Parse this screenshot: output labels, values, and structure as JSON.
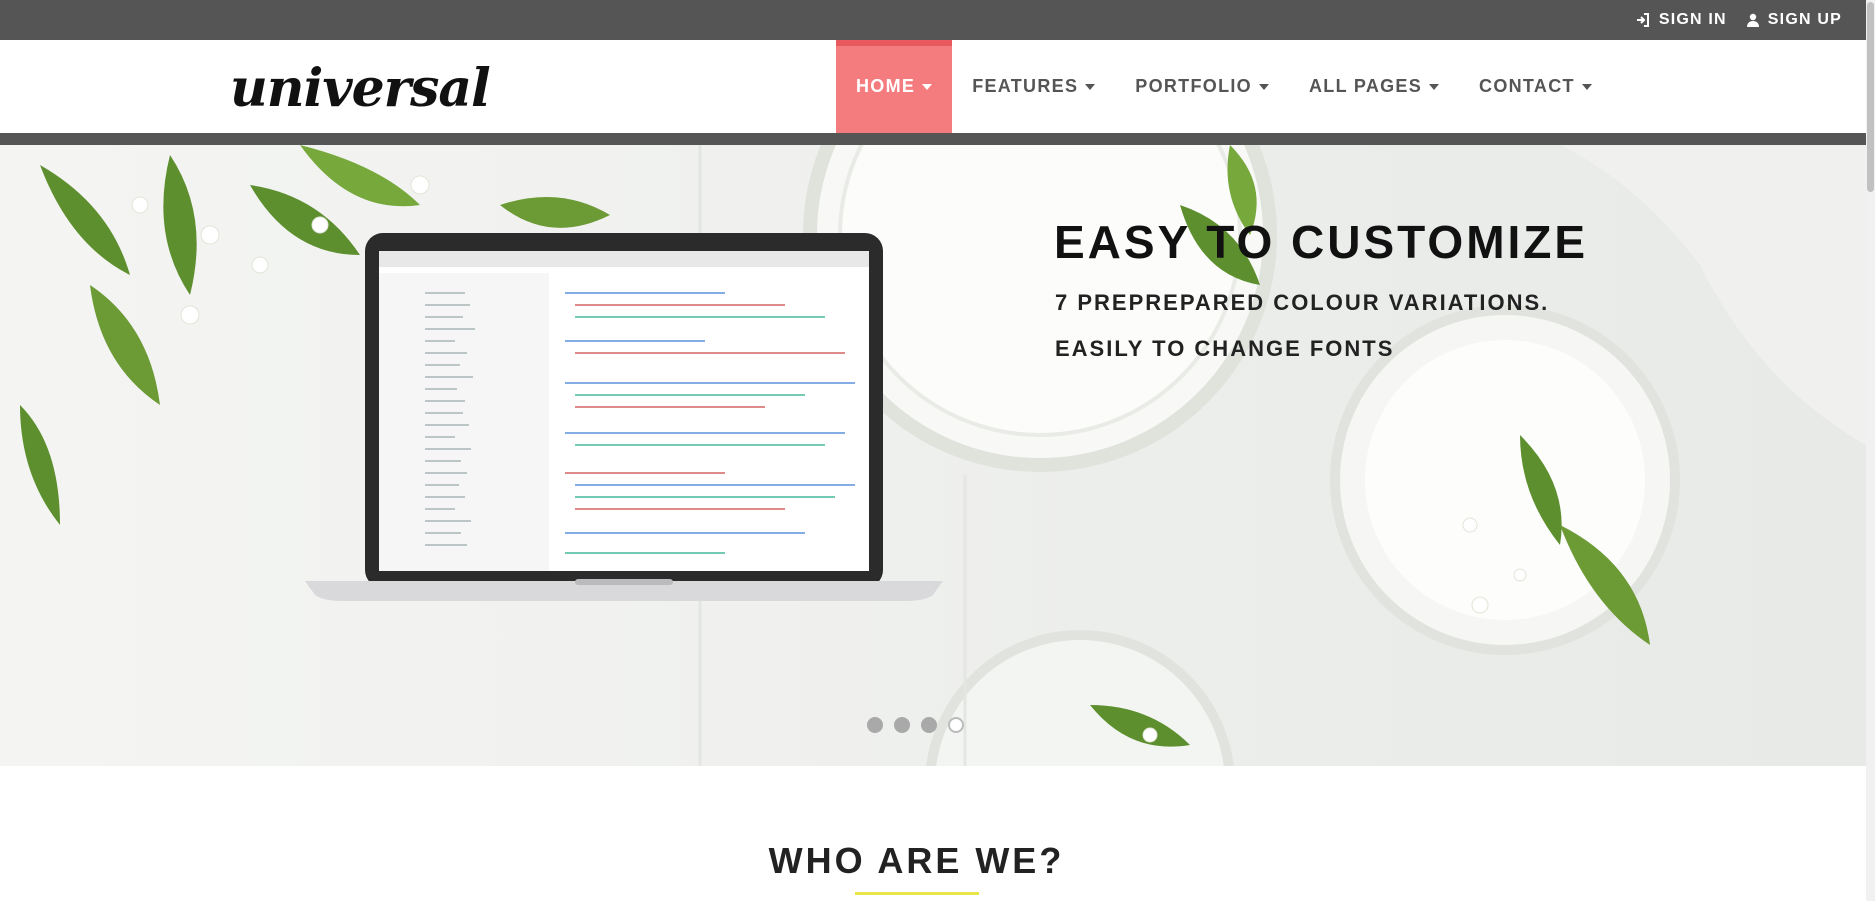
{
  "topbar": {
    "sign_in": "SIGN IN",
    "sign_up": "SIGN UP",
    "sign_in_icon": "sign-in-icon",
    "sign_up_icon": "user-icon"
  },
  "brand": {
    "logo_text": "universal"
  },
  "nav": {
    "items": [
      {
        "label": "HOME",
        "active": true
      },
      {
        "label": "FEATURES"
      },
      {
        "label": "PORTFOLIO"
      },
      {
        "label": "ALL PAGES"
      },
      {
        "label": "CONTACT"
      }
    ]
  },
  "hero": {
    "title": "EASY TO CUSTOMIZE",
    "line1": "7 PREPREPARED COLOUR VARIATIONS.",
    "line2": "EASILY TO CHANGE FONTS",
    "slides_total": 4,
    "active_slide": 4
  },
  "section": {
    "title": "WHO ARE WE?"
  },
  "colors": {
    "accent": "#f47c7f",
    "topbar": "#555555",
    "underline": "#e6e64a"
  }
}
